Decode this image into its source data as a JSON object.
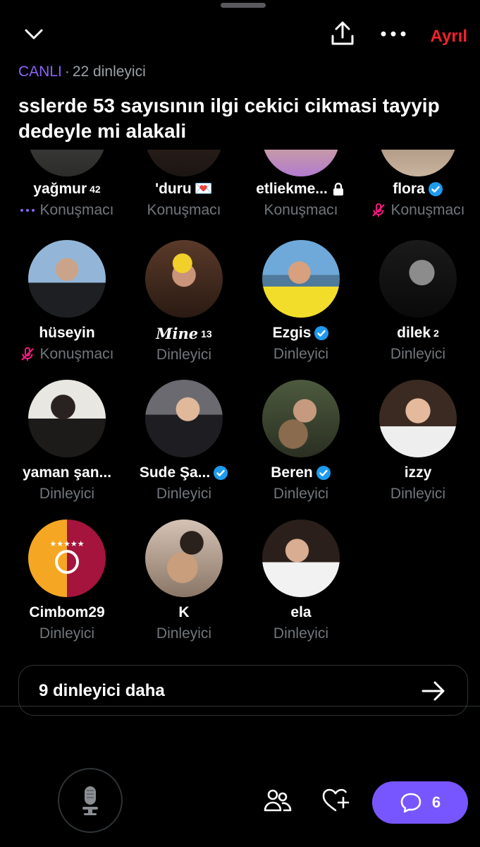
{
  "header": {
    "leave_label": "Ayrıl",
    "live_label": "CANLI",
    "separator": "·",
    "listener_count": "22 dinleyici",
    "title": "sslerde 53 sayısının ilgi cekici cikmasi tayyip dedeyle mi alakali"
  },
  "speakers_partial": [
    {
      "name": "yağmur",
      "sup": "42",
      "role": "Konuşmacı",
      "role_icon": "dots-icon"
    },
    {
      "name": "'duru",
      "emoji": "💌",
      "role": "Konuşmacı"
    },
    {
      "name": "etliekme...",
      "role": "Konuşmacı",
      "badge": "lock-icon"
    },
    {
      "name": "flora",
      "role": "Konuşmacı",
      "badge": "verified-icon",
      "role_icon": "mic-off-icon"
    }
  ],
  "rows": [
    [
      {
        "name": "hüseyin",
        "role": "Konuşmacı",
        "role_icon": "mic-off-icon"
      },
      {
        "name": "Mine",
        "sup": "13",
        "role": "Dinleyici",
        "italic": true
      },
      {
        "name": "Ezgis",
        "role": "Dinleyici",
        "badge": "verified-icon"
      },
      {
        "name": "dilek",
        "sup": "2",
        "role": "Dinleyici"
      }
    ],
    [
      {
        "name": "yaman şan...",
        "role": "Dinleyici"
      },
      {
        "name": "Sude Şa...",
        "role": "Dinleyici",
        "badge": "verified-icon"
      },
      {
        "name": "Beren",
        "role": "Dinleyici",
        "badge": "verified-icon"
      },
      {
        "name": "izzy",
        "role": "Dinleyici"
      }
    ],
    [
      {
        "name": "Cimbom29",
        "role": "Dinleyici"
      },
      {
        "name": "K",
        "role": "Dinleyici"
      },
      {
        "name": "ela",
        "role": "Dinleyici"
      }
    ]
  ],
  "more_listeners": "9 dinleyici daha",
  "footer": {
    "chat_count": "6"
  },
  "colors": {
    "accent": "#7856ff",
    "live": "#8b64f6",
    "leave": "#f4212e",
    "verified": "#1d9bf0",
    "mic_off": "#f91880"
  }
}
